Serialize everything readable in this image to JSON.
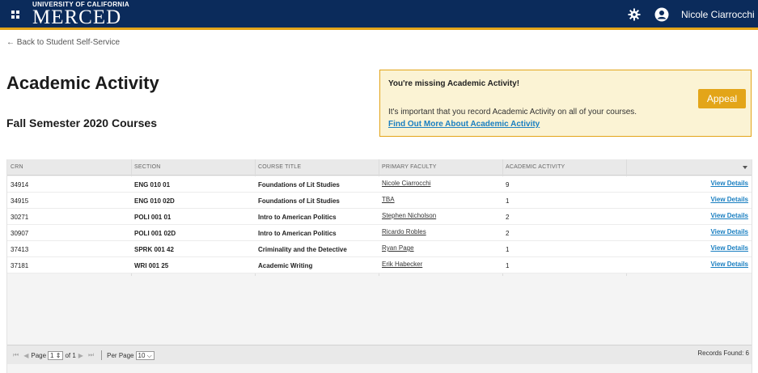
{
  "header": {
    "logo_sub": "UNIVERSITY OF CALIFORNIA",
    "logo_main": "MERCED",
    "user_name": "Nicole Ciarrocchi",
    "brand_color": "#0b2b5b",
    "accent_color": "#e3a519"
  },
  "back_link": "← Back to Student Self-Service",
  "page_title": "Academic Activity",
  "semester_heading": "Fall Semester 2020 Courses",
  "alert": {
    "title": "You're missing Academic Activity!",
    "text": "It's important that you record Academic Activity on all of your courses.",
    "link": "Find Out More About Academic Activity",
    "button": "Appeal"
  },
  "table": {
    "columns": [
      "CRN",
      "SECTION",
      "COURSE TITLE",
      "PRIMARY FACULTY",
      "ACADEMIC ACTIVITY"
    ],
    "rows": [
      {
        "crn": "34914",
        "section": "ENG 010 01",
        "title": "Foundations of Lit Studies",
        "faculty": "Nicole Ciarrocchi",
        "activity": "9",
        "action": "View Details"
      },
      {
        "crn": "34915",
        "section": "ENG 010 02D",
        "title": "Foundations of Lit Studies",
        "faculty": "TBA",
        "activity": "1",
        "action": "View Details"
      },
      {
        "crn": "30271",
        "section": "POLI 001 01",
        "title": "Intro to American Politics",
        "faculty": "Stephen Nicholson",
        "activity": "2",
        "action": "View Details"
      },
      {
        "crn": "30907",
        "section": "POLI 001 02D",
        "title": "Intro to American Politics",
        "faculty": "Ricardo Robles",
        "activity": "2",
        "action": "View Details"
      },
      {
        "crn": "37413",
        "section": "SPRK 001 42",
        "title": "Criminality and the Detective",
        "faculty": "Ryan Page",
        "activity": "1",
        "action": "View Details"
      },
      {
        "crn": "37181",
        "section": "WRI 001 25",
        "title": "Academic Writing",
        "faculty": "Erik Habecker",
        "activity": "1",
        "action": "View Details"
      }
    ]
  },
  "footer": {
    "page_label": "Page",
    "page_value": "1",
    "of_label": "of 1",
    "per_page_label": "Per Page",
    "per_page_value": "10",
    "records_found": "Records Found: 6"
  }
}
